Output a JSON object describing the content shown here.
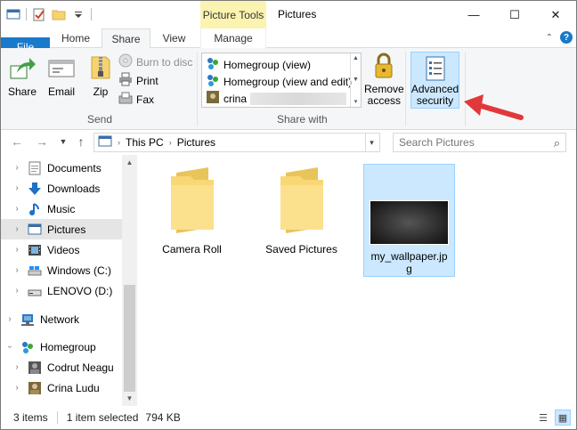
{
  "titlebar": {
    "context_tab": "Picture Tools",
    "title": "Pictures",
    "minimize": "—",
    "maximize": "☐",
    "close": "✕"
  },
  "tabs": {
    "file": "File",
    "home": "Home",
    "share": "Share",
    "view": "View",
    "manage": "Manage"
  },
  "ribbon": {
    "send": {
      "label": "Send",
      "share": "Share",
      "email": "Email",
      "zip": "Zip",
      "burn": "Burn to disc",
      "print": "Print",
      "fax": "Fax"
    },
    "share_with": {
      "label": "Share with",
      "items": [
        "Homegroup (view)",
        "Homegroup (view and edit)",
        "crina"
      ]
    },
    "remove_access": [
      "Remove",
      "access"
    ],
    "advanced_security": [
      "Advanced",
      "security"
    ]
  },
  "address": {
    "crumbs": [
      "This PC",
      "Pictures"
    ],
    "search_placeholder": "Search Pictures"
  },
  "nav": {
    "items": [
      {
        "label": "Documents"
      },
      {
        "label": "Downloads"
      },
      {
        "label": "Music"
      },
      {
        "label": "Pictures"
      },
      {
        "label": "Videos"
      },
      {
        "label": "Windows (C:)"
      },
      {
        "label": "LENOVO (D:)"
      },
      {
        "label": "Network"
      },
      {
        "label": "Homegroup"
      },
      {
        "label": "Codrut Neagu"
      },
      {
        "label": "Crina Ludu"
      }
    ]
  },
  "files": [
    {
      "name": "Camera Roll"
    },
    {
      "name": "Saved Pictures"
    },
    {
      "name_line1": "my_wallpaper.jp",
      "name_line2": "g"
    }
  ],
  "status": {
    "count": "3 items",
    "selected": "1 item selected",
    "size": "794 KB"
  },
  "colors": {
    "accent": "#1979ca",
    "context_tab": "#fbf4b0",
    "selection": "#cce8ff",
    "arrow": "#e2383c"
  }
}
